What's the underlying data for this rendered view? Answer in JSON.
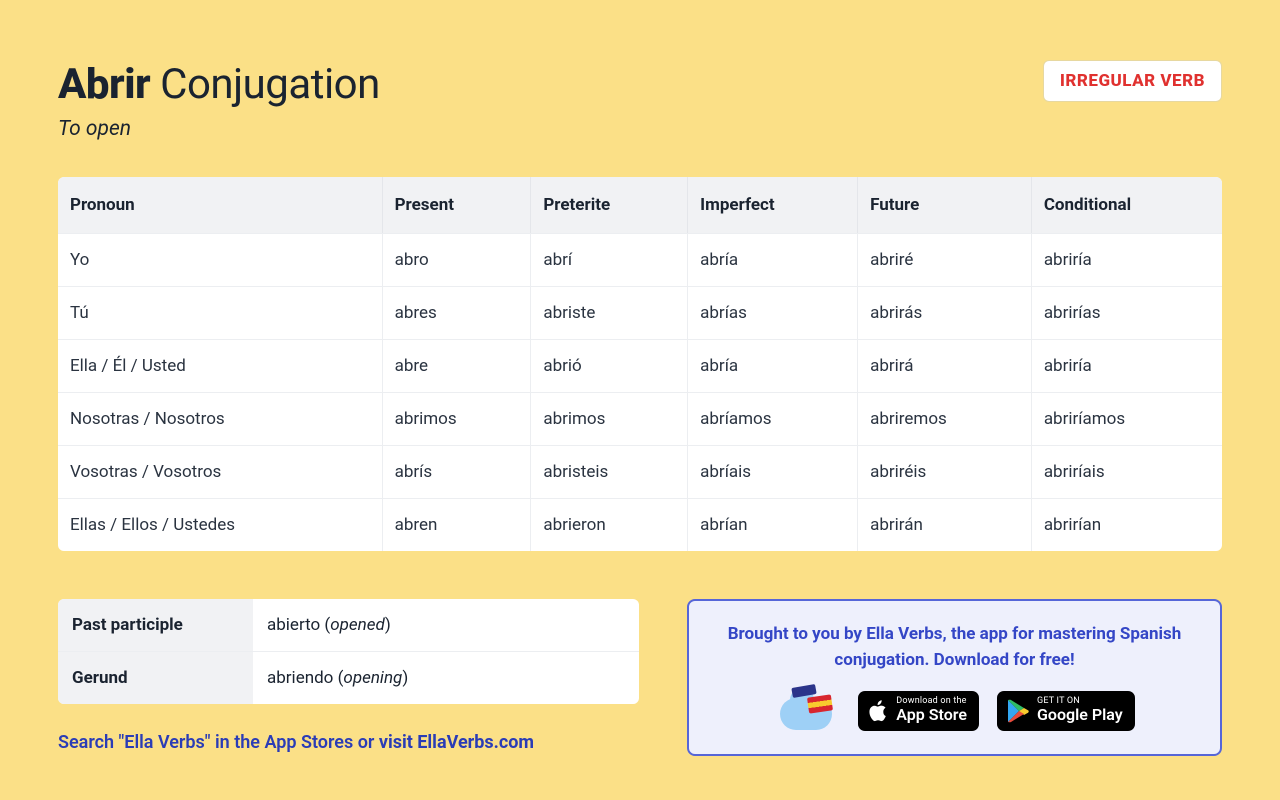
{
  "header": {
    "verb": "Abrir",
    "suffix": "Conjugation",
    "subtitle": "To open",
    "badge": "IRREGULAR VERB"
  },
  "table": {
    "columns": [
      "Pronoun",
      "Present",
      "Preterite",
      "Imperfect",
      "Future",
      "Conditional"
    ],
    "rows": [
      {
        "pronoun": "Yo",
        "present": "abro",
        "preterite": "abrí",
        "imperfect": "abría",
        "future": "abriré",
        "conditional": "abriría"
      },
      {
        "pronoun": "Tú",
        "present": "abres",
        "preterite": "abriste",
        "imperfect": "abrías",
        "future": "abrirás",
        "conditional": "abrirías"
      },
      {
        "pronoun": "Ella / Él / Usted",
        "present": "abre",
        "preterite": "abrió",
        "imperfect": "abría",
        "future": "abrirá",
        "conditional": "abriría"
      },
      {
        "pronoun": "Nosotras / Nosotros",
        "present": "abrimos",
        "preterite": "abrimos",
        "imperfect": "abríamos",
        "future": "abriremos",
        "conditional": "abriríamos"
      },
      {
        "pronoun": "Vosotras / Vosotros",
        "present": "abrís",
        "preterite": "abristeis",
        "imperfect": "abríais",
        "future": "abriréis",
        "conditional": "abriríais"
      },
      {
        "pronoun": "Ellas / Ellos / Ustedes",
        "present": "abren",
        "preterite": "abrieron",
        "imperfect": "abrían",
        "future": "abrirán",
        "conditional": "abrirían"
      }
    ]
  },
  "forms": {
    "past_participle": {
      "label": "Past participle",
      "value": "abierto",
      "gloss": "opened"
    },
    "gerund": {
      "label": "Gerund",
      "value": "abriendo",
      "gloss": "opening"
    }
  },
  "search_line": {
    "prefix": "Search \"Ella Verbs\" in the App Stores or ",
    "link": "visit EllaVerbs.com"
  },
  "promo": {
    "text": "Brought to you by Ella Verbs, the app for mastering Spanish conjugation. Download for free!",
    "appstore": {
      "small": "Download on the",
      "big": "App Store"
    },
    "play": {
      "small": "GET IT ON",
      "big": "Google Play"
    }
  }
}
